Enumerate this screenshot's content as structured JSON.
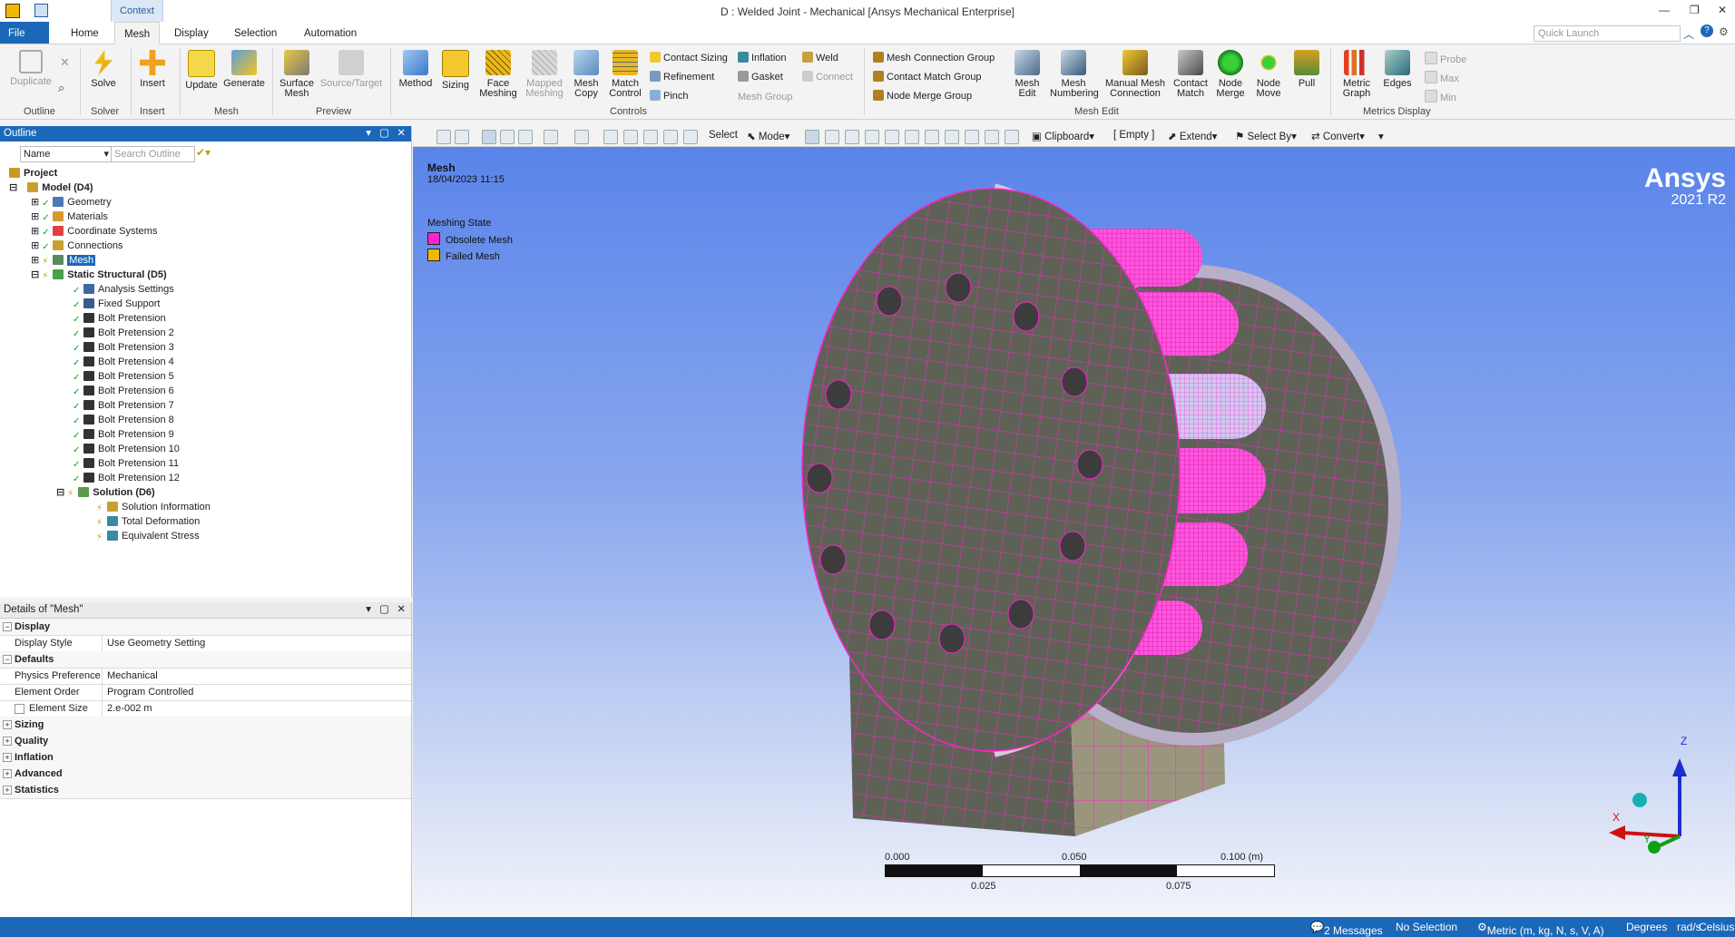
{
  "window": {
    "context_tab": "Context",
    "title": "D : Welded Joint - Mechanical [Ansys Mechanical Enterprise]",
    "quick_launch_placeholder": "Quick Launch"
  },
  "tabs": [
    "File",
    "Mesh",
    "Home",
    "Display",
    "Selection",
    "Automation"
  ],
  "ribbon": {
    "duplicate": "Duplicate",
    "outline_group": "Outline",
    "solve": "Solve",
    "solver_group": "Solver",
    "insert": "Insert",
    "insert_group": "Insert",
    "update": "Update",
    "generate": "Generate",
    "mesh_group": "Mesh",
    "surface_mesh": "Surface Mesh",
    "source_target": "Source/Target",
    "preview_group": "Preview",
    "method": "Method",
    "sizing": "Sizing",
    "face_meshing": "Face Meshing",
    "mapped_meshing": "Mapped Meshing",
    "mesh_copy": "Mesh Copy",
    "match_control": "Match Control",
    "controls_group": "Controls",
    "contact_sizing": "Contact Sizing",
    "refinement": "Refinement",
    "pinch": "Pinch",
    "inflation": "Inflation",
    "gasket": "Gasket",
    "mesh_group_label": "Mesh Group",
    "weld": "Weld",
    "connect": "Connect",
    "mesh_connection_group": "Mesh Connection Group",
    "contact_match_group": "Contact Match Group",
    "node_merge_group": "Node Merge Group",
    "mesh_edit": "Mesh Edit",
    "mesh_numbering": "Mesh Numbering",
    "manual_mesh_connection": "Manual Mesh Connection",
    "contact_match": "Contact Match",
    "node_merge": "Node Merge",
    "node_move": "Node Move",
    "pull": "Pull",
    "mesh_edit_group": "Mesh Edit",
    "metric_graph": "Metric Graph",
    "edges": "Edges",
    "probe": "Probe",
    "max": "Max",
    "min": "Min",
    "metrics_display_group": "Metrics Display"
  },
  "outline": {
    "title": "Outline",
    "filter_label": "Name",
    "search_placeholder": "Search Outline",
    "nodes": {
      "project": "Project",
      "model": "Model (D4)",
      "geometry": "Geometry",
      "materials": "Materials",
      "coord": "Coordinate Systems",
      "connections": "Connections",
      "mesh": "Mesh",
      "static": "Static Structural (D5)",
      "analysis": "Analysis Settings",
      "fixed": "Fixed Support",
      "bp1": "Bolt Pretension",
      "bp2": "Bolt Pretension 2",
      "bp3": "Bolt Pretension 3",
      "bp4": "Bolt Pretension 4",
      "bp5": "Bolt Pretension 5",
      "bp6": "Bolt Pretension 6",
      "bp7": "Bolt Pretension 7",
      "bp8": "Bolt Pretension 8",
      "bp9": "Bolt Pretension 9",
      "bp10": "Bolt Pretension 10",
      "bp11": "Bolt Pretension 11",
      "bp12": "Bolt Pretension 12",
      "solution": "Solution (D6)",
      "sol_info": "Solution Information",
      "total_def": "Total Deformation",
      "eq_stress": "Equivalent Stress"
    }
  },
  "details": {
    "title": "Details of \"Mesh\"",
    "display_cat": "Display",
    "display_style_k": "Display Style",
    "display_style_v": "Use Geometry Setting",
    "defaults_cat": "Defaults",
    "physics_k": "Physics Preference",
    "physics_v": "Mechanical",
    "order_k": "Element Order",
    "order_v": "Program Controlled",
    "size_k": "Element Size",
    "size_v": "2.e-002 m",
    "sizing_cat": "Sizing",
    "quality_cat": "Quality",
    "inflation_cat": "Inflation",
    "advanced_cat": "Advanced",
    "statistics_cat": "Statistics"
  },
  "graphics_toolbar": {
    "select": "Select",
    "mode": "Mode",
    "clipboard": "Clipboard",
    "empty": "[ Empty ]",
    "extend": "Extend",
    "select_by": "Select By",
    "convert": "Convert"
  },
  "viewport": {
    "label_title": "Mesh",
    "label_date": "18/04/2023 11:15",
    "legend_title": "Meshing State",
    "legend_obsolete": "Obsolete Mesh",
    "legend_failed": "Failed Mesh",
    "brand": "Ansys",
    "version": "2021 R2",
    "scale_0": "0.000",
    "scale_050": "0.050",
    "scale_100": "0.100 (m)",
    "scale_025": "0.025",
    "scale_075": "0.075",
    "axis_z": "Z",
    "axis_x": "X",
    "axis_y": "Y",
    "colors": {
      "obsolete": "#ff22cc",
      "failed": "#f0b800",
      "body": "#5e6256",
      "bracket": "#9a967e"
    }
  },
  "status": {
    "messages": "2 Messages",
    "selection": "No Selection",
    "units": "Metric (m, kg, N, s, V, A)",
    "degrees": "Degrees",
    "rads": "rad/s",
    "celsius": "Celsius"
  }
}
